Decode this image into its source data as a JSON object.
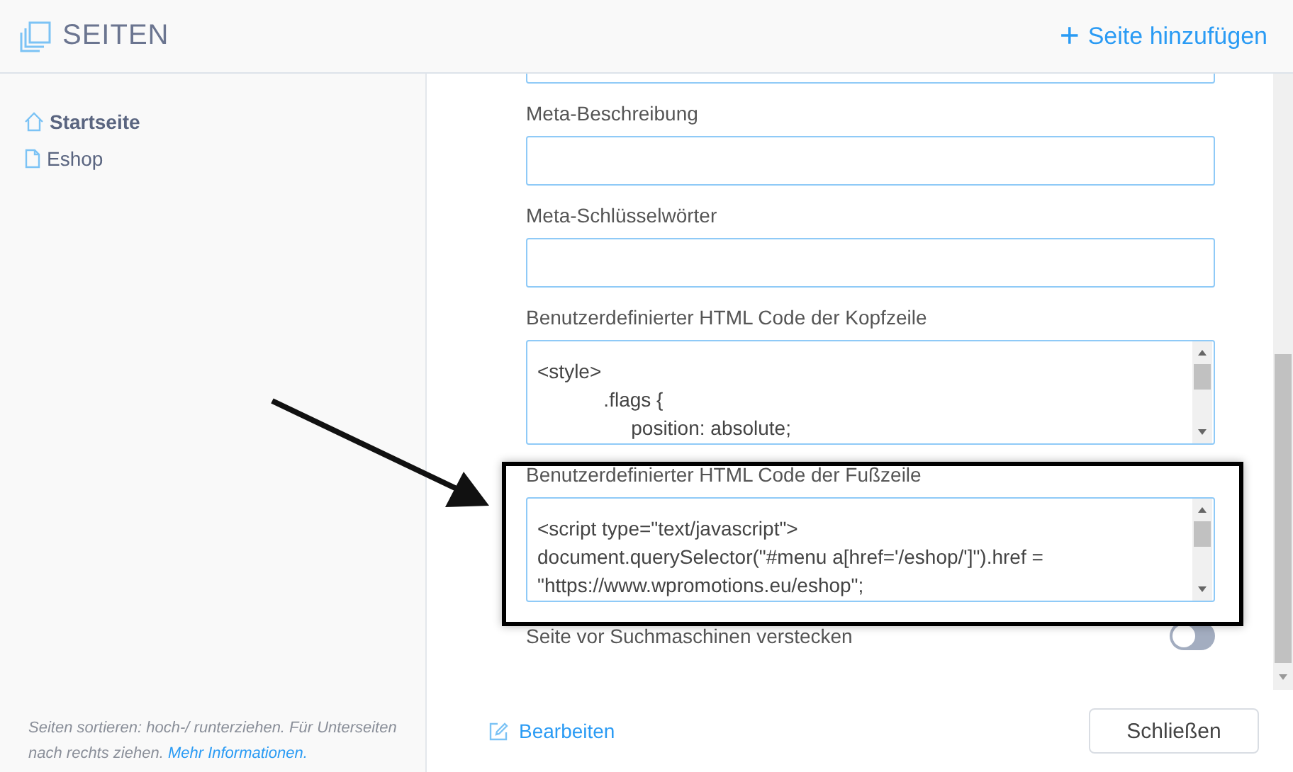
{
  "header": {
    "title": "SEITEN",
    "add_action": {
      "icon": "+",
      "label": "Seite hinzufügen"
    }
  },
  "sidebar": {
    "items": [
      {
        "kind": "home",
        "label": "Startseite",
        "selected": true
      },
      {
        "kind": "page",
        "label": "Eshop",
        "selected": false
      }
    ],
    "hint": {
      "text": "Seiten sortieren: hoch-/ runterziehen. Für Unterseiten nach rechts ziehen.",
      "link": "Mehr Informationen."
    }
  },
  "fields": [
    {
      "kind": "input"
    },
    {
      "kind": "input",
      "label": "Meta-Beschreibung"
    },
    {
      "kind": "input",
      "label": "Meta-Schlüsselwörter"
    },
    {
      "kind": "code",
      "label": "Benutzerdefinierter HTML Code der Kopfzeile",
      "lines": [
        "<style>",
        "            .flags {",
        "                 position: absolute;"
      ]
    },
    {
      "kind": "code",
      "label": "Benutzerdefinierter HTML Code der Fußzeile",
      "lines": [
        "<script type=\"text/javascript\">",
        "document.querySelector(\"#menu a[href='/eshop/']\").href =",
        "\"https://www.wpromotions.eu/eshop\";"
      ]
    }
  ],
  "hide_from_search": {
    "label": "Seite vor Suchmaschinen verstecken",
    "on": false
  },
  "footer": {
    "edit": "Bearbeiten",
    "close": "Schließen"
  }
}
